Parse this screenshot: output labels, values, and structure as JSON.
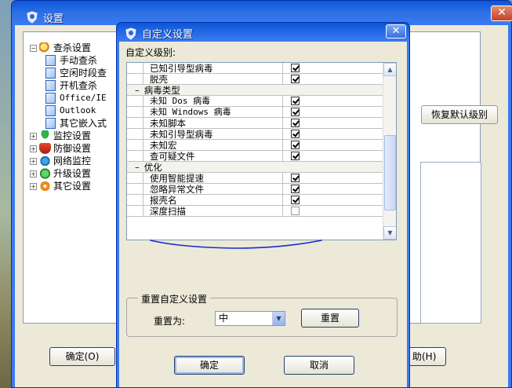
{
  "main_window": {
    "title": "设置",
    "close_symbol": "✕",
    "tree": [
      {
        "label": "查杀设置",
        "expanded": true,
        "icon": "search-scan-icon"
      },
      {
        "label": "手动查杀",
        "child": true,
        "selected": true
      },
      {
        "label": "空闲时段查",
        "child": true
      },
      {
        "label": "开机查杀",
        "child": true
      },
      {
        "label": "Office/IE",
        "child": true
      },
      {
        "label": "Outlook",
        "child": true
      },
      {
        "label": "其它嵌入式",
        "child": true
      },
      {
        "label": "监控设置",
        "icon": "umbrella-icon"
      },
      {
        "label": "防御设置",
        "icon": "shield-icon"
      },
      {
        "label": "网络监控",
        "icon": "network-icon"
      },
      {
        "label": "升级设置",
        "icon": "upgrade-icon"
      },
      {
        "label": "其它设置",
        "icon": "gear-icon"
      }
    ],
    "restore_default_label": "恢复默认级别",
    "ok_label": "确定(O)",
    "help_label": "助(H)"
  },
  "dialog": {
    "title": "自定义设置",
    "close_symbol": "✕",
    "level_label": "自定义级别:",
    "rows": [
      {
        "type": "item",
        "label": "已知引导型病毒",
        "checked": true
      },
      {
        "type": "item",
        "label": "脱壳",
        "checked": true
      },
      {
        "type": "category",
        "label": "病毒类型",
        "toggle": "–"
      },
      {
        "type": "item",
        "label": "未知 Dos 病毒",
        "checked": true,
        "mono": true
      },
      {
        "type": "item",
        "label": "未知 Windows 病毒",
        "checked": true,
        "mono": true
      },
      {
        "type": "item",
        "label": "未知脚本",
        "checked": true
      },
      {
        "type": "item",
        "label": "未知引导型病毒",
        "checked": true
      },
      {
        "type": "item",
        "label": "未知宏",
        "checked": true
      },
      {
        "type": "item",
        "label": "查可疑文件",
        "checked": true
      },
      {
        "type": "category",
        "label": "优化",
        "toggle": "–"
      },
      {
        "type": "item",
        "label": "使用智能提速",
        "checked": true
      },
      {
        "type": "item",
        "label": "忽略异常文件",
        "checked": true
      },
      {
        "type": "item",
        "label": "报壳名",
        "checked": true
      },
      {
        "type": "item",
        "label": "深度扫描",
        "checked": false
      }
    ],
    "reset_group_title": "重置自定义设置",
    "reset_to_label": "重置为:",
    "reset_level_value": "中",
    "reset_button_label": "重置",
    "ok_label": "确定",
    "cancel_label": "取消"
  },
  "colors": {
    "title_bar": "#3a7af0",
    "dialog_face": "#ece9d8",
    "annotation_ink": "#1a2ad0"
  }
}
